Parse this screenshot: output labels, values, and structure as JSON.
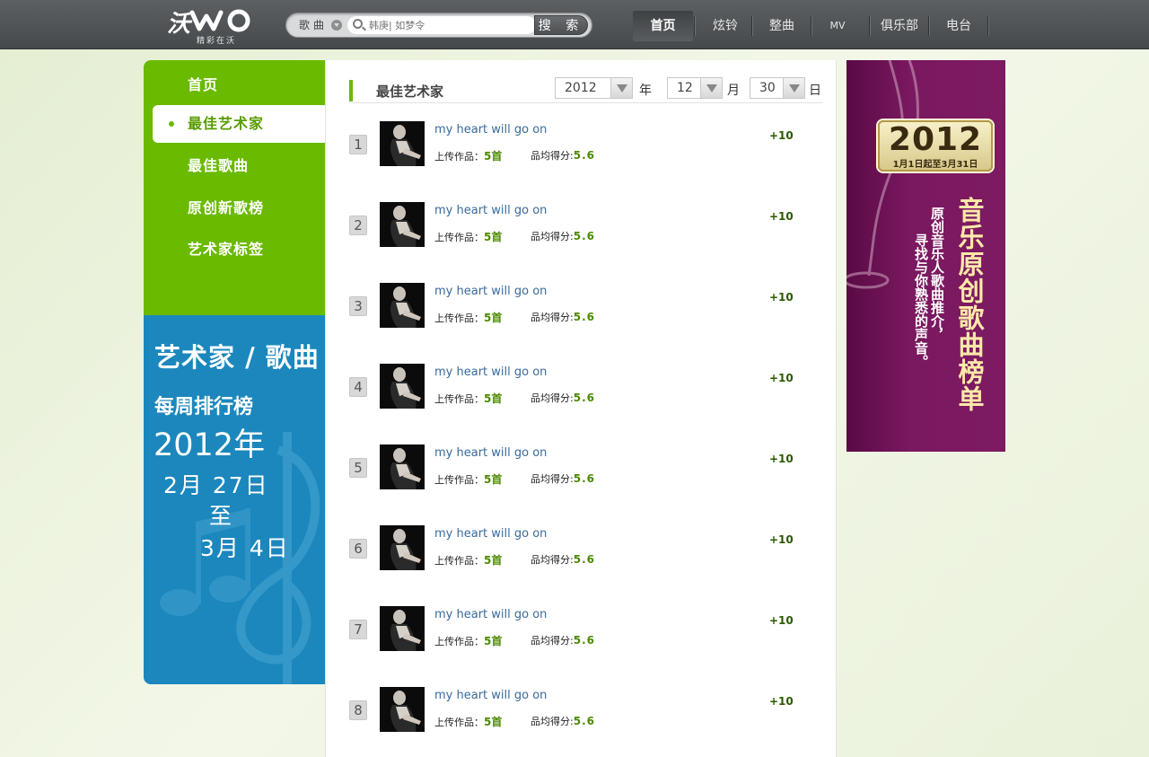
{
  "header": {
    "logo_text": "沃",
    "logo_tagline": "精彩在沃",
    "search": {
      "category": "歌曲",
      "placeholder": "韩庚| 如梦令",
      "button": "搜 索"
    },
    "nav": [
      {
        "label": "首页",
        "active": true
      },
      {
        "label": "炫铃",
        "active": false
      },
      {
        "label": "整曲",
        "active": false
      },
      {
        "label": "MV",
        "active": false
      },
      {
        "label": "俱乐部",
        "active": false
      },
      {
        "label": "电台",
        "active": false
      }
    ]
  },
  "sidebar": {
    "items": [
      {
        "label": "首页",
        "selected": false
      },
      {
        "label": "最佳艺术家",
        "selected": true
      },
      {
        "label": "最佳歌曲",
        "selected": false
      },
      {
        "label": "原创新歌榜",
        "selected": false
      },
      {
        "label": "艺术家标签",
        "selected": false
      }
    ],
    "banner": {
      "line1": "艺术家 / 歌曲",
      "line2": "每周排行榜",
      "line3": "2012年",
      "line4": "2月  27日",
      "line5": "至",
      "line6": "3月   4日"
    }
  },
  "main": {
    "title": "最佳艺术家",
    "date": {
      "year": "2012",
      "year_unit": "年",
      "month": "12",
      "month_unit": "月",
      "day": "30",
      "day_unit": "日"
    },
    "rows": [
      {
        "rank": "1",
        "song": "my heart will go on",
        "upload_label": "上传作品：",
        "upload_value": "5首",
        "score_label": "品均得分:",
        "score_value": "5.6",
        "delta": "+10"
      },
      {
        "rank": "2",
        "song": "my heart will go on",
        "upload_label": "上传作品：",
        "upload_value": "5首",
        "score_label": "品均得分:",
        "score_value": "5.6",
        "delta": "+10"
      },
      {
        "rank": "3",
        "song": "my heart will go on",
        "upload_label": "上传作品：",
        "upload_value": "5首",
        "score_label": "品均得分:",
        "score_value": "5.6",
        "delta": "+10"
      },
      {
        "rank": "4",
        "song": "my heart will go on",
        "upload_label": "上传作品：",
        "upload_value": "5首",
        "score_label": "品均得分:",
        "score_value": "5.6",
        "delta": "+10"
      },
      {
        "rank": "5",
        "song": "my heart will go on",
        "upload_label": "上传作品：",
        "upload_value": "5首",
        "score_label": "品均得分:",
        "score_value": "5.6",
        "delta": "+10"
      },
      {
        "rank": "6",
        "song": "my heart will go on",
        "upload_label": "上传作品：",
        "upload_value": "5首",
        "score_label": "品均得分:",
        "score_value": "5.6",
        "delta": "+10"
      },
      {
        "rank": "7",
        "song": "my heart will go on",
        "upload_label": "上传作品：",
        "upload_value": "5首",
        "score_label": "品均得分:",
        "score_value": "5.6",
        "delta": "+10"
      },
      {
        "rank": "8",
        "song": "my heart will go on",
        "upload_label": "上传作品：",
        "upload_value": "5首",
        "score_label": "品均得分:",
        "score_value": "5.6",
        "delta": "+10"
      }
    ]
  },
  "ad": {
    "year": "2012",
    "date_range": "1月1日起至3月31日",
    "headline": "音乐原创歌曲榜单",
    "sub1": "原创音乐人歌曲推介，",
    "sub2": "寻找与你熟悉的声音。"
  },
  "colors": {
    "brand_green": "#6aba00",
    "banner_blue": "#1b87bd",
    "ad_purple": "#7a1860",
    "header_gray": "#505355"
  }
}
